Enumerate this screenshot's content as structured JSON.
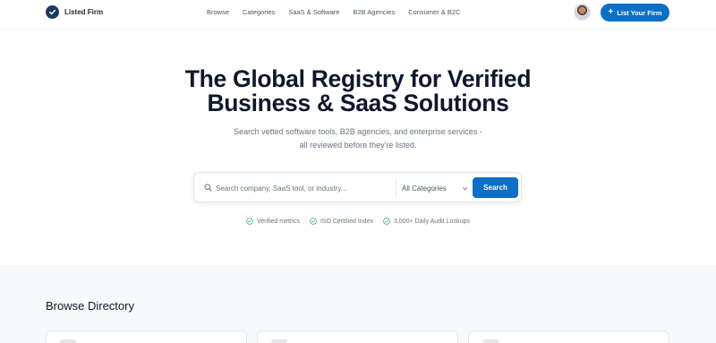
{
  "brand": {
    "name": "Listed Firm",
    "logo_icon": "check-badge-icon",
    "logo_color": "#1e3a5f"
  },
  "nav": {
    "links": [
      "Browse",
      "Categories",
      "SaaS & Software",
      "B2B Agencies",
      "Consumer & B2C"
    ],
    "cta_label": "List Your Firm",
    "cta_icon": "plus-icon"
  },
  "hero": {
    "title_line1": "The Global Registry for Verified",
    "title_line2": "Business & SaaS Solutions",
    "subtitle_line1": "Search vetted software tools, B2B agencies, and enterprise services -",
    "subtitle_line2": "all reviewed before they're listed."
  },
  "search": {
    "placeholder": "Search company, SaaS tool, or industry...",
    "value": "",
    "category_selected": "All Categories",
    "button_label": "Search"
  },
  "trust": [
    "Verified metrics",
    "ISO Certified Index",
    "3,000+ Daily Audit Lookups"
  ],
  "directory": {
    "title": "Browse Directory"
  },
  "colors": {
    "accent": "#0b6fc5",
    "check": "#34a86b"
  }
}
